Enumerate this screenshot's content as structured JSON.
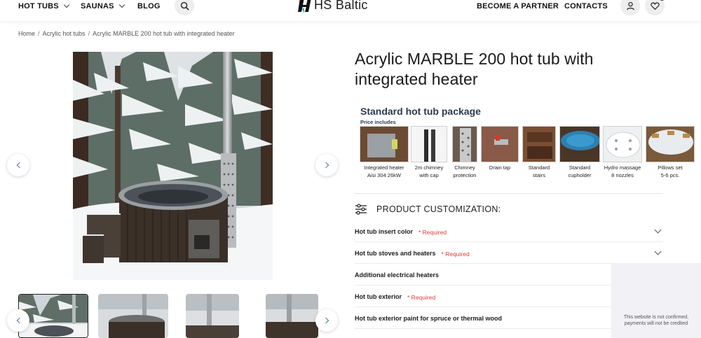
{
  "header": {
    "nav_left": [
      "HOT TUBS",
      "SAUNAS",
      "BLOG"
    ],
    "logo_text": "HS Baltic",
    "nav_right": [
      "BECOME A PARTNER",
      "CONTACTS"
    ],
    "icons": {
      "search": "search-icon",
      "account": "user-icon",
      "wishlist": "heart-icon"
    }
  },
  "breadcrumb": [
    "Home",
    "Acrylic hot tubs",
    "Acrylic MARBLE 200 hot tub with integrated heater"
  ],
  "product": {
    "title": "Acrylic MARBLE 200 hot tub with integrated heater"
  },
  "package": {
    "title": "Standard hot tub package",
    "subtitle": "Price includes",
    "items": [
      {
        "line1": "Integrated heater",
        "line2": "Aisi 304 26kW"
      },
      {
        "line1": "2m chimney",
        "line2": "with cap"
      },
      {
        "line1": "Chimney",
        "line2": "protection"
      },
      {
        "line1": "Drain tap",
        "line2": ""
      },
      {
        "line1": "Standard",
        "line2": "stairs"
      },
      {
        "line1": "Standard",
        "line2": "cupholder"
      },
      {
        "line1": "Hydro massage",
        "line2": "8 nozzles"
      },
      {
        "line1": "Pillows set",
        "line2": "5-6 pcs."
      }
    ]
  },
  "customization": {
    "heading": "PRODUCT CUSTOMIZATION:",
    "required_label": "* Required",
    "options": [
      {
        "label": "Hot tub insert color",
        "required": true,
        "expandable": true
      },
      {
        "label": "Hot tub stoves and heaters",
        "required": true,
        "expandable": true
      },
      {
        "label": "Additional electrical heaters",
        "required": false,
        "expandable": false
      },
      {
        "label": "Hot tub exterior",
        "required": true,
        "expandable": false
      },
      {
        "label": "Hot tub exterior paint for spruce or thermal wood",
        "required": false,
        "expandable": false
      }
    ]
  },
  "notice": {
    "line1": "This website is not confirmed,",
    "line2": "payments will not be credited"
  },
  "colors": {
    "accent_blue": "#1f3c8a",
    "required_red": "#e23a3a",
    "package_title": "#2d3a4d",
    "arrow": "#5572a8"
  }
}
